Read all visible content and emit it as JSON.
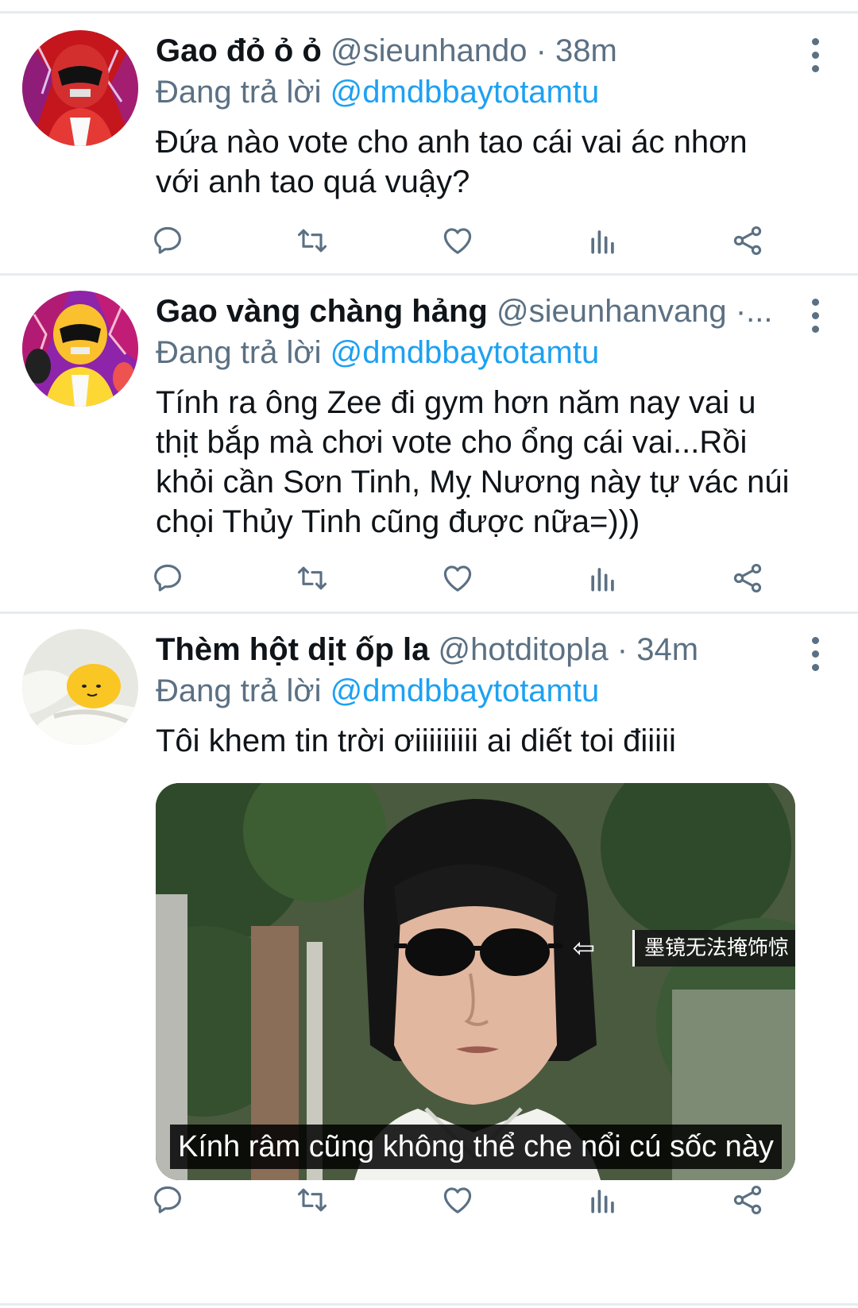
{
  "tweets": [
    {
      "display_name": "Gao đỏ ỏ ỏ",
      "handle": "@sieunhando",
      "separator": "·",
      "time": "38m",
      "reply_prefix": "Đang trả lời",
      "reply_to": "@dmdbbaytotamtu",
      "text_lines": [
        "Đứa nào vote cho anh tao cái vai ác nhơn",
        "với anh tao quá vuậy?"
      ],
      "avatar_theme": "red-ranger"
    },
    {
      "display_name": "Gao vàng chàng hảng",
      "handle": "@sieunhanvang",
      "separator": "·...",
      "time": "",
      "reply_prefix": "Đang trả lời",
      "reply_to": "@dmdbbaytotamtu",
      "text_lines": [
        "Tính ra ông Zee đi gym hơn năm nay vai u",
        "thịt bắp mà chơi vote cho ổng cái vai...Rồi",
        "khỏi cần Sơn Tinh, Mỵ Nương này tự vác núi",
        "chọi Thủy Tinh cũng được nữa=)))"
      ],
      "avatar_theme": "yellow-ranger"
    },
    {
      "display_name": "Thèm hột dịt ốp la",
      "handle": "@hotditopla",
      "separator": "·",
      "time": "34m",
      "reply_prefix": "Đang trả lời",
      "reply_to": "@dmdbbaytotamtu",
      "text_lines": [
        "Tôi khem tin trời ơiiiiiiiii ai diết toi điiiii"
      ],
      "avatar_theme": "gudetama",
      "media": {
        "caption": "Kính râm cũng không thể che nổi cú sốc này",
        "subtitle": "墨镜无法掩饰惊",
        "arrow": "⇦"
      }
    }
  ],
  "action_icons": [
    "reply-icon",
    "retweet-icon",
    "like-icon",
    "analytics-icon",
    "share-icon"
  ],
  "colors": {
    "link": "#1da1f2",
    "secondary": "#5b7083",
    "divider": "#e6ecf0",
    "text": "#0f1419"
  }
}
